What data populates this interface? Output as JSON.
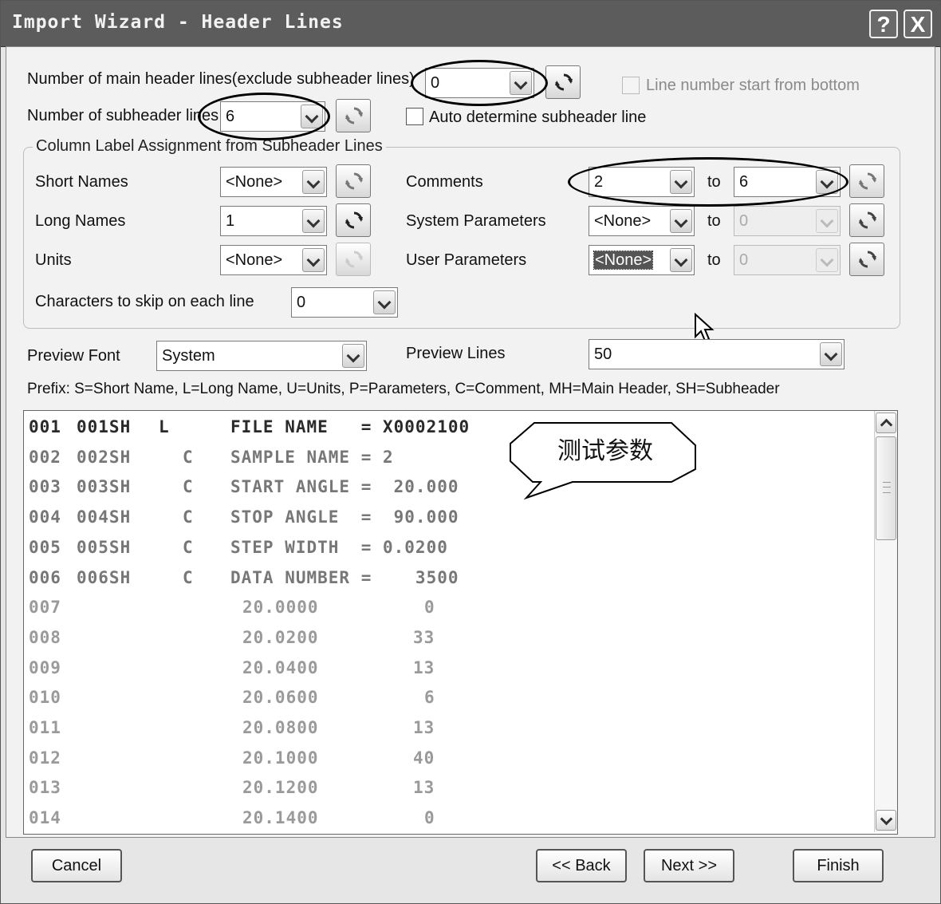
{
  "window": {
    "title": "Import Wizard - Header Lines",
    "help_icon": "?",
    "close_icon": "X"
  },
  "main_header": {
    "label": "Number of main header lines(exclude subheader lines)",
    "value": "0"
  },
  "line_number_bottom": {
    "label": "Line number start from bottom",
    "checked": false,
    "enabled": false
  },
  "subheader": {
    "label": "Number of subheader lines",
    "value": "6"
  },
  "auto_determine": {
    "label": "Auto determine subheader line",
    "checked": false
  },
  "group": {
    "title": "Column Label Assignment from Subheader Lines",
    "short_names": {
      "label": "Short Names",
      "value": "<None>"
    },
    "long_names": {
      "label": "Long Names",
      "value": "1"
    },
    "units": {
      "label": "Units",
      "value": "<None>"
    },
    "skip_chars": {
      "label": "Characters to skip on each line",
      "value": "0"
    },
    "comments": {
      "label": "Comments",
      "from": "2",
      "to_label": "to",
      "to": "6"
    },
    "system_params": {
      "label": "System Parameters",
      "from": "<None>",
      "to_label": "to",
      "to": "0"
    },
    "user_params": {
      "label": "User Parameters",
      "from": "<None>",
      "to_label": "to",
      "to": "0"
    }
  },
  "preview_font": {
    "label": "Preview Font",
    "value": "System"
  },
  "preview_lines": {
    "label": "Preview Lines",
    "value": "50"
  },
  "prefix_text": "Prefix:  S=Short Name, L=Long Name, U=Units, P=Parameters, C=Comment, MH=Main Header, SH=Subheader",
  "preview_rows": [
    {
      "num": "001",
      "tag": "001SH",
      "pfx": "L",
      "text": "FILE NAME   = X0002100"
    },
    {
      "num": "002",
      "tag": "002SH",
      "pfx": "C",
      "text": "SAMPLE NAME = 2"
    },
    {
      "num": "003",
      "tag": "003SH",
      "pfx": "C",
      "text": "START ANGLE =  20.000"
    },
    {
      "num": "004",
      "tag": "004SH",
      "pfx": "C",
      "text": "STOP ANGLE  =  90.000"
    },
    {
      "num": "005",
      "tag": "005SH",
      "pfx": "C",
      "text": "STEP WIDTH  = 0.0200"
    },
    {
      "num": "006",
      "tag": "006SH",
      "pfx": "C",
      "text": "DATA NUMBER =    3500"
    },
    {
      "num": "007",
      "x": "20.0000",
      "y": "0"
    },
    {
      "num": "008",
      "x": "20.0200",
      "y": "33"
    },
    {
      "num": "009",
      "x": "20.0400",
      "y": "13"
    },
    {
      "num": "010",
      "x": "20.0600",
      "y": "6"
    },
    {
      "num": "011",
      "x": "20.0800",
      "y": "13"
    },
    {
      "num": "012",
      "x": "20.1000",
      "y": "40"
    },
    {
      "num": "013",
      "x": "20.1200",
      "y": "13"
    },
    {
      "num": "014",
      "x": "20.1400",
      "y": "0"
    }
  ],
  "callout_text": "测试参数",
  "buttons": {
    "cancel": "Cancel",
    "back": "<< Back",
    "next": "Next >>",
    "finish": "Finish"
  },
  "icons": {
    "refresh": "refresh-icon",
    "dropdown": "chevron-down-icon",
    "scroll_up": "chevron-up-icon",
    "scroll_down": "chevron-down-icon",
    "cursor": "mouse-pointer-icon"
  }
}
